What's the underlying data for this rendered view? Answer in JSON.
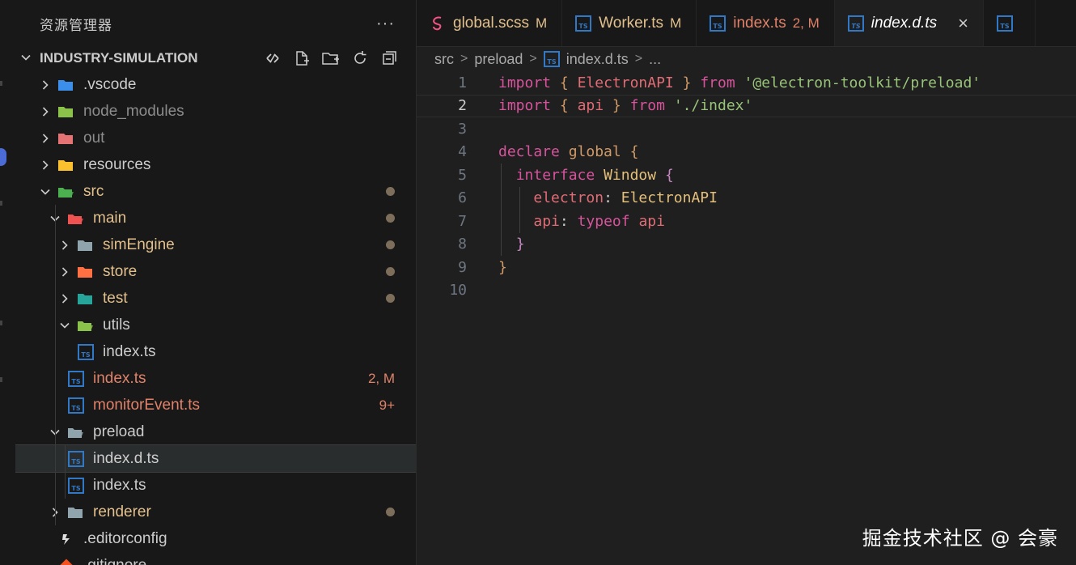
{
  "explorer": {
    "title": "资源管理器",
    "more": "···",
    "project_name": "INDUSTRY-SIMULATION",
    "actions": [
      {
        "name": "collapse-toggle-icon"
      },
      {
        "name": "new-file-icon"
      },
      {
        "name": "new-folder-icon"
      },
      {
        "name": "refresh-icon"
      },
      {
        "name": "collapse-all-icon"
      }
    ],
    "items": [
      {
        "label": ".vscode",
        "kind": "folder",
        "icon": "vscode-folder-icon",
        "color": "#3b8eea",
        "expanded": false,
        "depth": 0,
        "state": "norm",
        "status": ""
      },
      {
        "label": "node_modules",
        "kind": "folder",
        "icon": "node-folder-icon",
        "color": "#8bc34a",
        "expanded": false,
        "depth": 0,
        "state": "ignored",
        "status": ""
      },
      {
        "label": "out",
        "kind": "folder",
        "icon": "out-folder-icon",
        "color": "#e57373",
        "expanded": false,
        "depth": 0,
        "state": "ignored",
        "status": ""
      },
      {
        "label": "resources",
        "kind": "folder",
        "icon": "resources-folder-icon",
        "color": "#fbc02d",
        "expanded": false,
        "depth": 0,
        "state": "norm",
        "status": ""
      },
      {
        "label": "src",
        "kind": "folder",
        "icon": "src-folder-icon",
        "color": "#4caf50",
        "expanded": true,
        "depth": 0,
        "state": "mod",
        "status": "dot"
      },
      {
        "label": "main",
        "kind": "folder",
        "icon": "main-folder-icon",
        "color": "#ef5350",
        "expanded": true,
        "depth": 1,
        "state": "mod",
        "status": "dot"
      },
      {
        "label": "simEngine",
        "kind": "folder",
        "icon": "folder-icon",
        "color": "#90a4ae",
        "expanded": false,
        "depth": 2,
        "state": "mod",
        "status": "dot"
      },
      {
        "label": "store",
        "kind": "folder",
        "icon": "store-folder-icon",
        "color": "#ff7043",
        "expanded": false,
        "depth": 2,
        "state": "mod",
        "status": "dot"
      },
      {
        "label": "test",
        "kind": "folder",
        "icon": "test-folder-icon",
        "color": "#26a69a",
        "expanded": false,
        "depth": 2,
        "state": "mod",
        "status": "dot"
      },
      {
        "label": "utils",
        "kind": "folder",
        "icon": "utils-folder-icon",
        "color": "#8bc34a",
        "expanded": true,
        "depth": 2,
        "state": "norm",
        "status": ""
      },
      {
        "label": "index.ts",
        "kind": "file",
        "icon": "typescript-file-icon",
        "color": "#3178c6",
        "expanded": false,
        "depth": 3,
        "state": "norm",
        "status": ""
      },
      {
        "label": "index.ts",
        "kind": "file",
        "icon": "typescript-file-icon",
        "color": "#3178c6",
        "expanded": false,
        "depth": 2,
        "state": "err",
        "status": "2, M"
      },
      {
        "label": "monitorEvent.ts",
        "kind": "file",
        "icon": "typescript-file-icon",
        "color": "#3178c6",
        "expanded": false,
        "depth": 2,
        "state": "err",
        "status": "9+"
      },
      {
        "label": "preload",
        "kind": "folder",
        "icon": "folder-open-icon",
        "color": "#90a4ae",
        "expanded": true,
        "depth": 1,
        "state": "norm",
        "status": ""
      },
      {
        "label": "index.d.ts",
        "kind": "file",
        "icon": "typescript-file-icon",
        "color": "#3178c6",
        "expanded": false,
        "depth": 2,
        "state": "norm",
        "status": "",
        "selected": true
      },
      {
        "label": "index.ts",
        "kind": "file",
        "icon": "typescript-file-icon",
        "color": "#3178c6",
        "expanded": false,
        "depth": 2,
        "state": "norm",
        "status": ""
      },
      {
        "label": "renderer",
        "kind": "folder",
        "icon": "folder-icon",
        "color": "#90a4ae",
        "expanded": false,
        "depth": 1,
        "state": "mod",
        "status": "dot"
      },
      {
        "label": ".editorconfig",
        "kind": "file",
        "icon": "editorconfig-file-icon",
        "color": "#e0e0e0",
        "expanded": false,
        "depth": 0,
        "state": "norm",
        "status": ""
      },
      {
        "label": ".gitignore",
        "kind": "file",
        "icon": "git-file-icon",
        "color": "#f4511e",
        "expanded": false,
        "depth": 0,
        "state": "norm",
        "status": ""
      }
    ]
  },
  "tabs": [
    {
      "label": "global.scss",
      "badge": "M",
      "icon": "scss-file-icon",
      "color": "#f55385",
      "state": "mod",
      "active": false
    },
    {
      "label": "Worker.ts",
      "badge": "M",
      "icon": "typescript-file-icon",
      "color": "#3178c6",
      "state": "mod",
      "active": false
    },
    {
      "label": "index.ts",
      "badge": "2, M",
      "icon": "typescript-file-icon",
      "color": "#3178c6",
      "state": "err",
      "active": false
    },
    {
      "label": "index.d.ts",
      "badge": "",
      "icon": "typescript-file-icon",
      "color": "#3178c6",
      "state": "active",
      "active": true,
      "close": "×"
    },
    {
      "label": "",
      "badge": "",
      "icon": "typescript-file-icon",
      "color": "#3178c6",
      "state": "norm",
      "active": false
    }
  ],
  "breadcrumb": {
    "parts": [
      "src",
      "preload",
      "index.d.ts",
      "..."
    ],
    "separator": ">"
  },
  "code": {
    "current_line": 2,
    "lines": [
      [
        [
          "kw2",
          "import"
        ],
        [
          "pl",
          " "
        ],
        [
          "br",
          "{"
        ],
        [
          "pl",
          " "
        ],
        [
          "id",
          "ElectronAPI"
        ],
        [
          "pl",
          " "
        ],
        [
          "br",
          "}"
        ],
        [
          "pl",
          " "
        ],
        [
          "kw2",
          "from"
        ],
        [
          "pl",
          " "
        ],
        [
          "st",
          "'@electron-toolkit/preload'"
        ]
      ],
      [
        [
          "kw2",
          "import"
        ],
        [
          "pl",
          " "
        ],
        [
          "br",
          "{"
        ],
        [
          "pl",
          " "
        ],
        [
          "id",
          "api"
        ],
        [
          "pl",
          " "
        ],
        [
          "br",
          "}"
        ],
        [
          "pl",
          " "
        ],
        [
          "kw2",
          "from"
        ],
        [
          "pl",
          " "
        ],
        [
          "st",
          "'./index'"
        ]
      ],
      [],
      [
        [
          "kw2",
          "declare"
        ],
        [
          "pl",
          " "
        ],
        [
          "dec",
          "global"
        ],
        [
          "pl",
          " "
        ],
        [
          "br",
          "{"
        ]
      ],
      [
        [
          "pl",
          "  "
        ],
        [
          "kw2",
          "interface"
        ],
        [
          "pl",
          " "
        ],
        [
          "ty",
          "Window"
        ],
        [
          "pl",
          " "
        ],
        [
          "kw",
          "{"
        ]
      ],
      [
        [
          "pl",
          "    "
        ],
        [
          "id",
          "electron"
        ],
        [
          "pl",
          ": "
        ],
        [
          "ty",
          "ElectronAPI"
        ]
      ],
      [
        [
          "pl",
          "    "
        ],
        [
          "id",
          "api"
        ],
        [
          "pl",
          ": "
        ],
        [
          "kw2",
          "typeof"
        ],
        [
          "pl",
          " "
        ],
        [
          "id",
          "api"
        ]
      ],
      [
        [
          "pl",
          "  "
        ],
        [
          "kw",
          "}"
        ]
      ],
      [
        [
          "br",
          "}"
        ]
      ],
      []
    ]
  },
  "watermark": "掘金技术社区 @ 会豪"
}
